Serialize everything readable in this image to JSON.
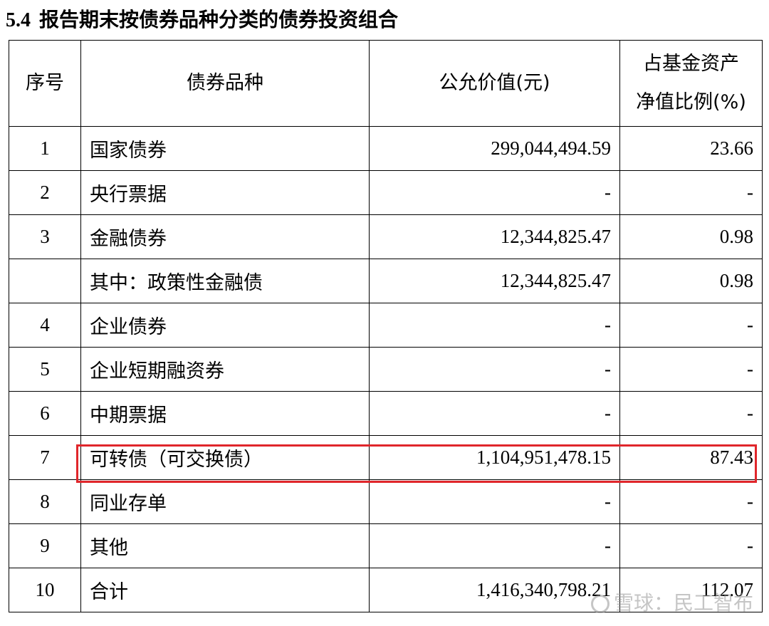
{
  "section": {
    "number": "5.4",
    "title": "报告期末按债券品种分类的债券投资组合"
  },
  "table": {
    "headers": {
      "seq": "序号",
      "category": "债券品种",
      "fair_value": "公允价值(元)",
      "ratio_line1": "占基金资产",
      "ratio_line2": "净值比例(%)"
    },
    "rows": [
      {
        "seq": "1",
        "name": "国家债券",
        "value": "299,044,494.59",
        "ratio": "23.66"
      },
      {
        "seq": "2",
        "name": "央行票据",
        "value": "-",
        "ratio": "-"
      },
      {
        "seq": "3",
        "name": "金融债券",
        "value": "12,344,825.47",
        "ratio": "0.98"
      },
      {
        "seq": "",
        "name": "其中：政策性金融债",
        "value": "12,344,825.47",
        "ratio": "0.98"
      },
      {
        "seq": "4",
        "name": "企业债券",
        "value": "-",
        "ratio": "-"
      },
      {
        "seq": "5",
        "name": "企业短期融资券",
        "value": "-",
        "ratio": "-"
      },
      {
        "seq": "6",
        "name": "中期票据",
        "value": "-",
        "ratio": "-"
      },
      {
        "seq": "7",
        "name": "可转债（可交换债）",
        "value": "1,104,951,478.15",
        "ratio": "87.43"
      },
      {
        "seq": "8",
        "name": "同业存单",
        "value": "-",
        "ratio": "-"
      },
      {
        "seq": "9",
        "name": "其他",
        "value": "-",
        "ratio": "-"
      },
      {
        "seq": "10",
        "name": "合计",
        "value": "1,416,340,798.21",
        "ratio": "112.07"
      }
    ]
  },
  "highlight": {
    "row_seq": "7",
    "color": "#e0262b"
  },
  "watermark": {
    "text": "雪球：民工智布",
    "icon": "snowball-icon"
  }
}
